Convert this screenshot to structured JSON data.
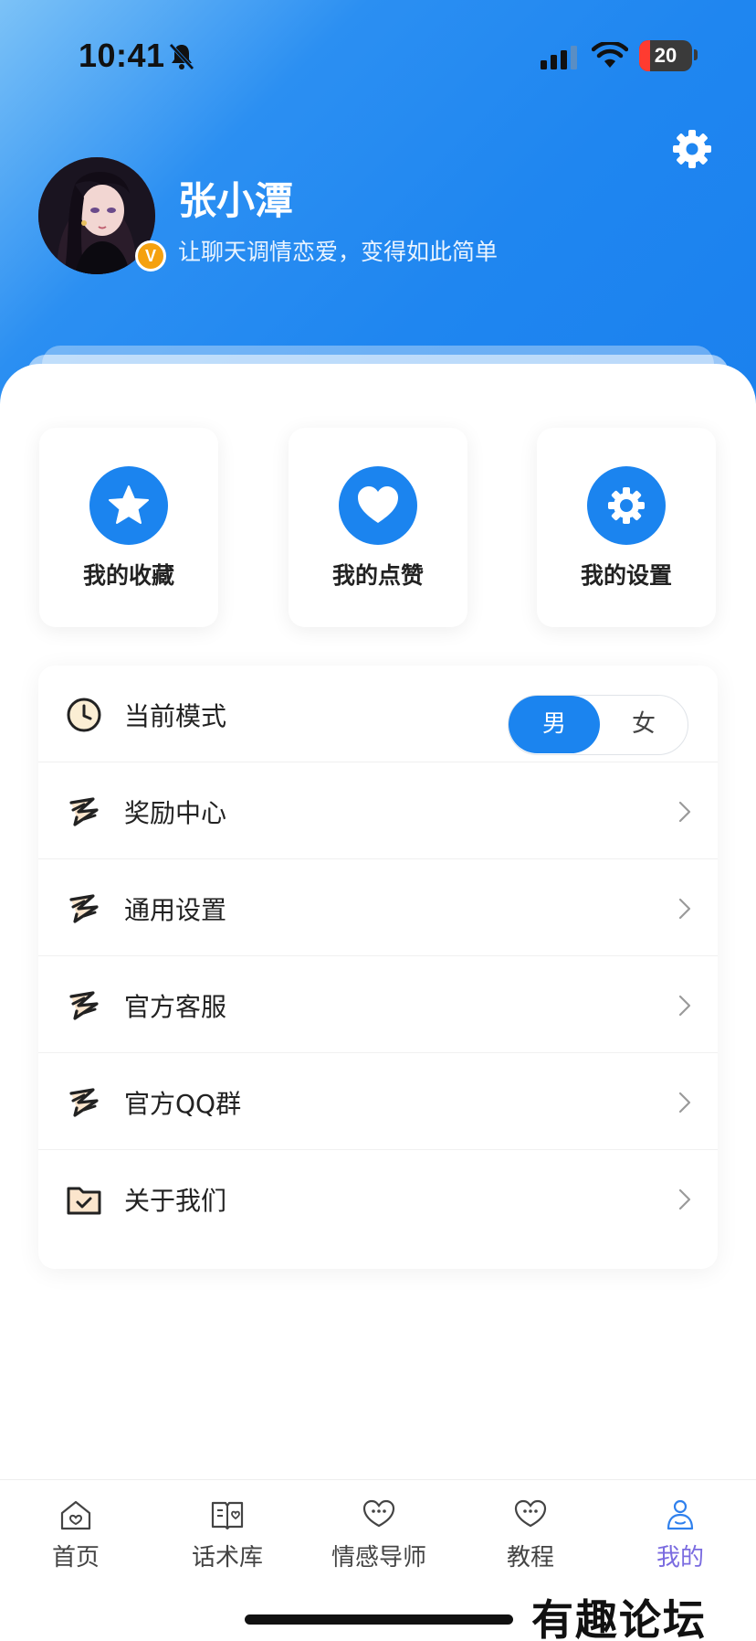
{
  "status_bar": {
    "time": "10:41",
    "battery": "20"
  },
  "profile": {
    "name": "张小潭",
    "slogan": "让聊天调情恋爱，变得如此简单",
    "badge": "V"
  },
  "quick_actions": [
    {
      "label": "我的收藏",
      "icon": "star-icon"
    },
    {
      "label": "我的点赞",
      "icon": "heart-icon"
    },
    {
      "label": "我的设置",
      "icon": "gear-icon"
    }
  ],
  "menu": {
    "mode": {
      "label": "当前模式",
      "options": [
        "男",
        "女"
      ],
      "selected": "男"
    },
    "items": [
      {
        "label": "奖励中心"
      },
      {
        "label": "通用设置"
      },
      {
        "label": "官方客服"
      },
      {
        "label": "官方QQ群"
      },
      {
        "label": "关于我们"
      }
    ]
  },
  "tabbar": {
    "items": [
      {
        "label": "首页",
        "icon": "home-icon"
      },
      {
        "label": "话术库",
        "icon": "book-icon"
      },
      {
        "label": "情感导师",
        "icon": "chat-heart-icon"
      },
      {
        "label": "教程",
        "icon": "chat-heart-icon"
      },
      {
        "label": "我的",
        "icon": "person-icon"
      }
    ],
    "active": "我的"
  },
  "watermark": "有趣论坛",
  "colors": {
    "accent": "#1b84ef",
    "active_tab": "#7a6be0",
    "badge": "#f5a10f"
  }
}
